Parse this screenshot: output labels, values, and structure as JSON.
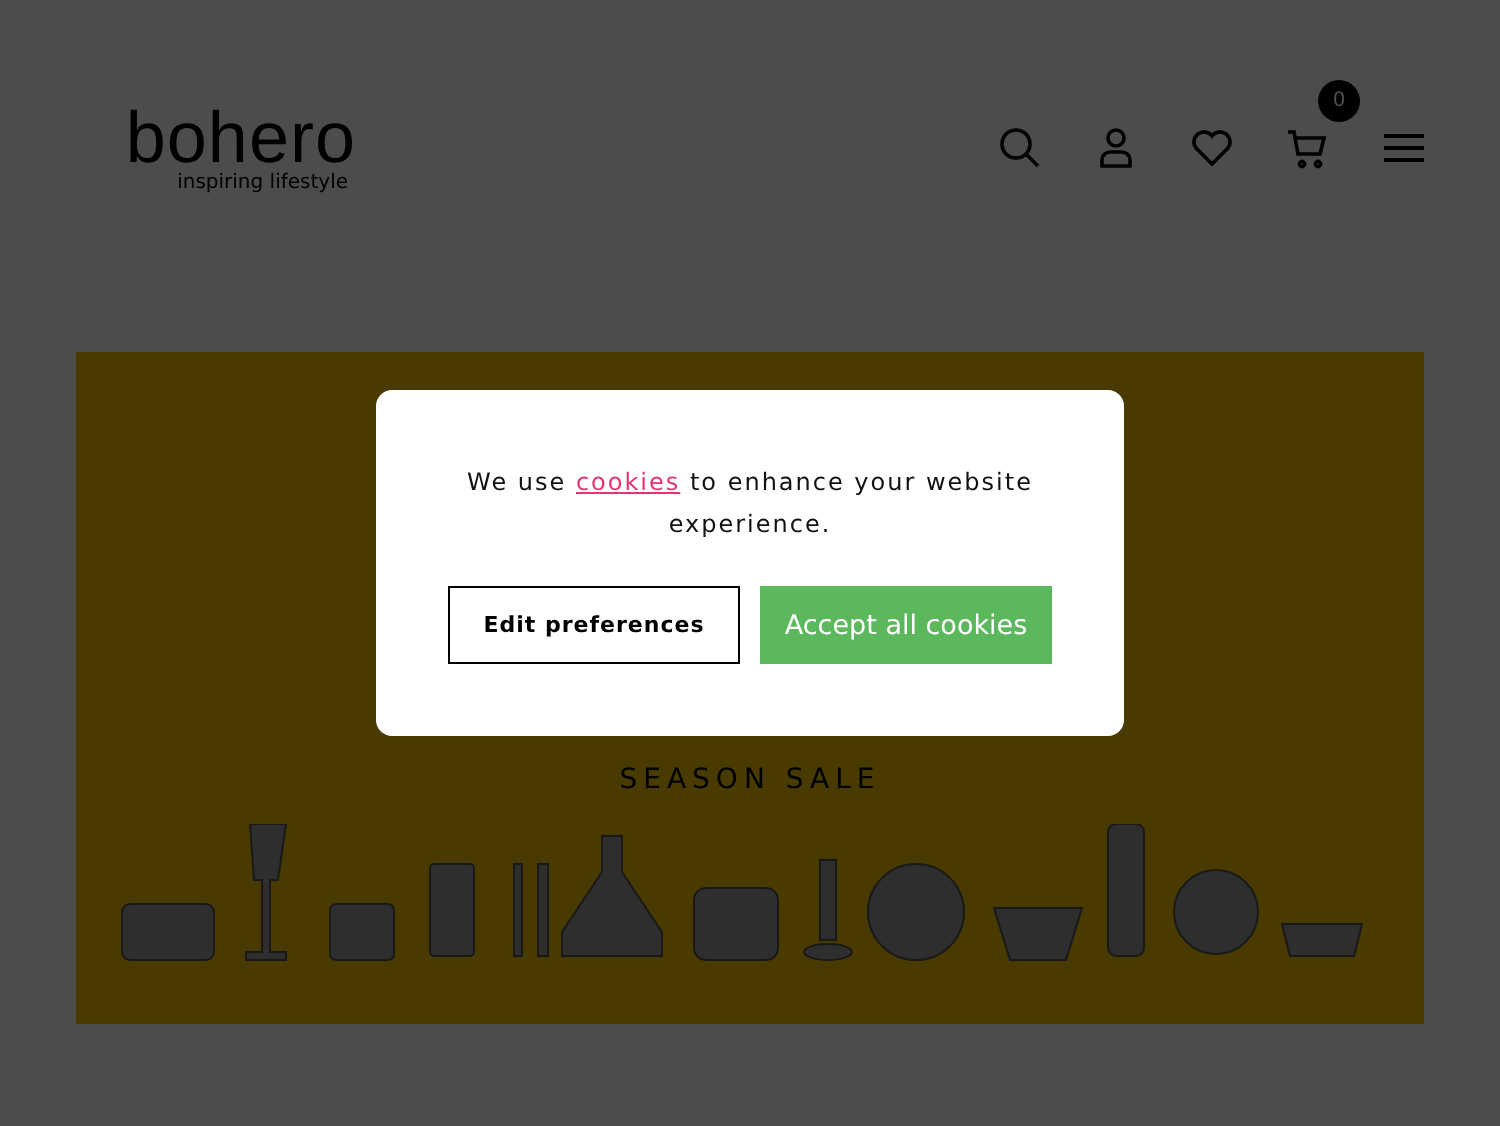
{
  "header": {
    "logo": "bohero",
    "tagline": "inspiring lifestyle",
    "cart_count": "0"
  },
  "banner": {
    "title": "SEASON SALE"
  },
  "cookie_dialog": {
    "message_before": "We use ",
    "link": "cookies",
    "message_after": " to enhance your website experience.",
    "buttons": [
      {
        "kind": "outline",
        "label": "Edit preferences"
      },
      {
        "kind": "primary",
        "label": "Accept all cookies"
      }
    ]
  }
}
